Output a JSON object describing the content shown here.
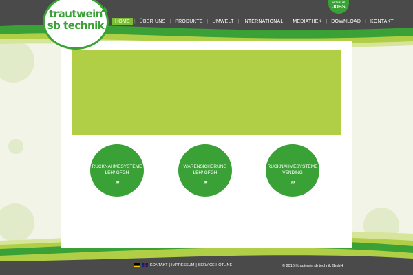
{
  "logo": {
    "line1": "trautwein",
    "line2": "sb technik"
  },
  "nav": {
    "items": [
      "HOME",
      "ÜBER UNS",
      "PRODUKTE",
      "UMWELT",
      "INTERNATIONAL",
      "MEDIATHEK",
      "DOWNLOAD",
      "KONTAKT"
    ],
    "active": "HOME",
    "separator": "|"
  },
  "jobs_badge": {
    "line1": "AKTUELLE",
    "line2": "JOBS"
  },
  "tiles": [
    {
      "line1": "RÜCKNAHMESYSTEME",
      "line2": "LEH/ GFGH",
      "arrows": "›››"
    },
    {
      "line1": "WARENSICHERUNG",
      "line2": "LEH/ GFGH",
      "arrows": "›››"
    },
    {
      "line1": "RÜCKNAHMESYSTEME",
      "line2": "VENDING",
      "arrows": "›››"
    }
  ],
  "footer": {
    "links": [
      "KONTAKT",
      "IMPRESSUM",
      "SERVICE HOTLINE"
    ],
    "separator": "|",
    "copyright": "© 2016 | trautwein sb technik GmbH"
  },
  "colors": {
    "dark": "#4a4a4a",
    "green": "#3aa136",
    "lime": "#b0cf47",
    "nav_active": "#7ebd36",
    "background": "#f1f4e7"
  }
}
